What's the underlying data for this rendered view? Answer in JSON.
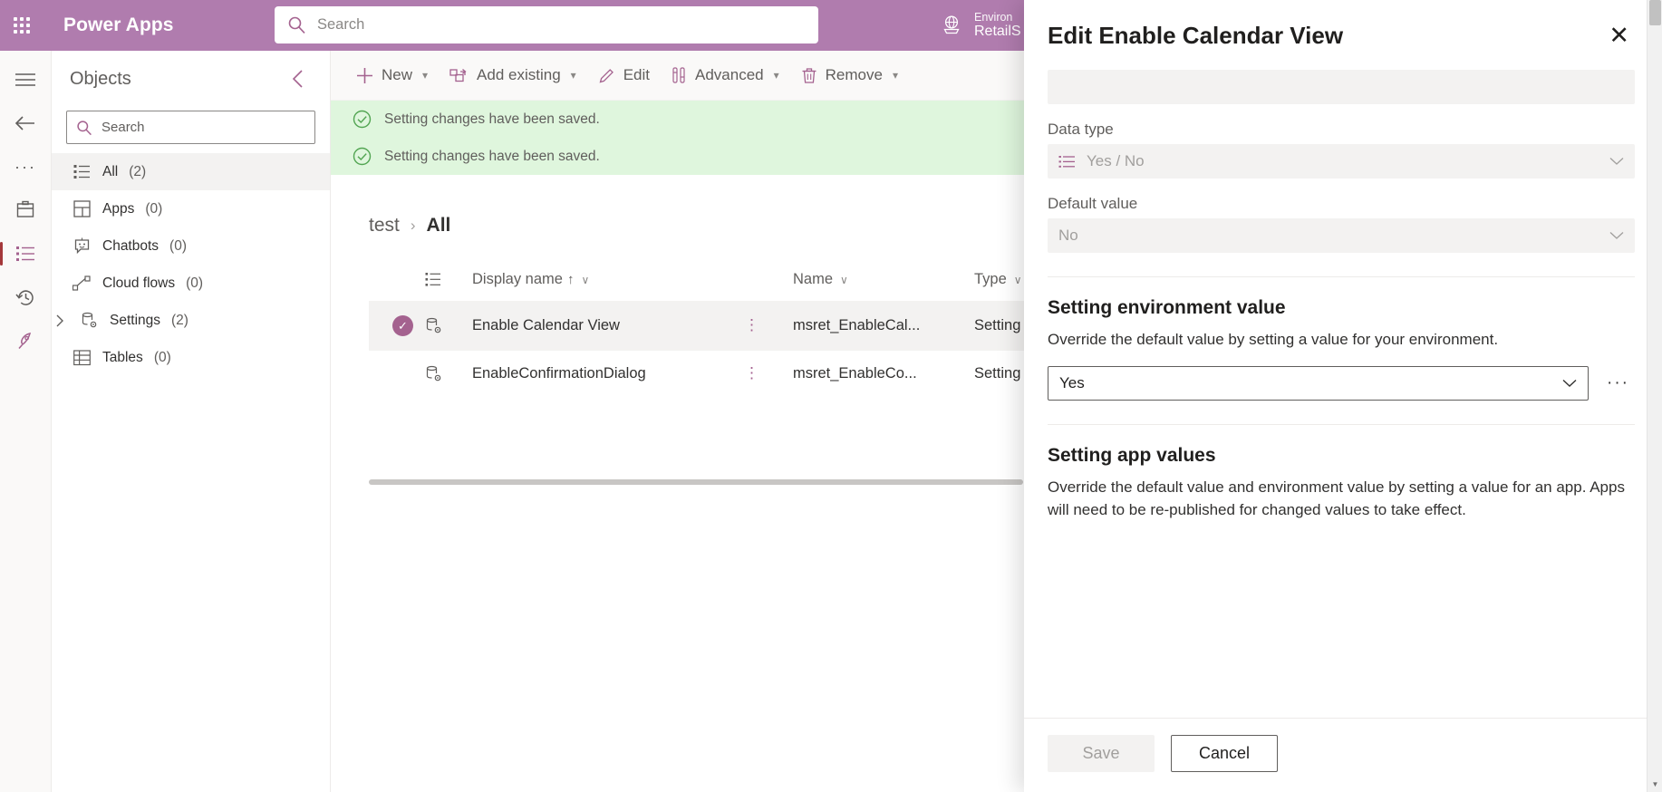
{
  "topbar": {
    "waffle_label": "app-launcher",
    "brand": "Power Apps",
    "search_placeholder": "Search",
    "search_value": "",
    "env_label": "Environ",
    "env_name": "RetailS"
  },
  "objects_panel": {
    "title": "Objects",
    "collapse_glyph": "‹",
    "search_placeholder": "Search",
    "search_value": "",
    "items": [
      {
        "label": "All",
        "count": "(2)",
        "icon": "list-icon",
        "expandable": false,
        "selected": true
      },
      {
        "label": "Apps",
        "count": "(0)",
        "icon": "apps-icon",
        "expandable": false,
        "selected": false
      },
      {
        "label": "Chatbots",
        "count": "(0)",
        "icon": "chatbot-icon",
        "expandable": false,
        "selected": false
      },
      {
        "label": "Cloud flows",
        "count": "(0)",
        "icon": "flow-icon",
        "expandable": false,
        "selected": false
      },
      {
        "label": "Settings",
        "count": "(2)",
        "icon": "settings-icon",
        "expandable": true,
        "selected": false
      },
      {
        "label": "Tables",
        "count": "(0)",
        "icon": "table-icon",
        "expandable": false,
        "selected": false
      }
    ]
  },
  "command_bar": {
    "back_glyph": "‹",
    "items": [
      {
        "label": "New",
        "icon": "plus-icon",
        "has_chevron": true
      },
      {
        "label": "Add existing",
        "icon": "add-existing-icon",
        "has_chevron": true
      },
      {
        "label": "Edit",
        "icon": "pencil-icon",
        "has_chevron": false
      },
      {
        "label": "Advanced",
        "icon": "advanced-icon",
        "has_chevron": true
      },
      {
        "label": "Remove",
        "icon": "trash-icon",
        "has_chevron": true
      }
    ]
  },
  "notifications": [
    {
      "icon": "check-circle-icon",
      "message": "Setting changes have been saved."
    },
    {
      "icon": "check-circle-icon",
      "message": "Setting changes have been saved."
    }
  ],
  "breadcrumb": {
    "parent": "test",
    "separator": "›",
    "current": "All"
  },
  "grid": {
    "columns": [
      {
        "label": "Display name",
        "sort": "↑",
        "chevron": "∨"
      },
      {
        "label": "Name",
        "sort": "",
        "chevron": "∨"
      },
      {
        "label": "Type",
        "sort": "",
        "chevron": "∨"
      }
    ],
    "rows": [
      {
        "selected": true,
        "check_glyph": "✓",
        "row_icon": "setting-record-icon",
        "display_name": "Enable Calendar View",
        "kebab": "⋮",
        "name": "msret_EnableCal...",
        "type": "Setting"
      },
      {
        "selected": false,
        "check_glyph": "",
        "row_icon": "setting-record-icon",
        "display_name": "EnableConfirmationDialog",
        "kebab": "⋮",
        "name": "msret_EnableCo...",
        "type": "Setting"
      }
    ]
  },
  "edit_panel": {
    "title": "Edit Enable Calendar View",
    "close_glyph": "✕",
    "top_readonly_value": "",
    "data_type": {
      "label": "Data type",
      "value": "Yes / No",
      "icon": "choice-list-icon",
      "chevron": "∨",
      "disabled": true
    },
    "default_value": {
      "label": "Default value",
      "value": "No",
      "chevron": "∨",
      "disabled": true
    },
    "environment_section": {
      "title": "Setting environment value",
      "description": "Override the default value by setting a value for your environment.",
      "combo_value": "Yes",
      "chevron": "∨",
      "overflow_glyph": "···"
    },
    "app_section": {
      "title": "Setting app values",
      "description": "Override the default value and environment value by setting a value for an app. Apps will need to be re-published for changed values to take effect."
    },
    "footer": {
      "save_label": "Save",
      "cancel_label": "Cancel"
    }
  },
  "colors": {
    "brand_purple": "#b07cae",
    "accent_purple": "#a4628f",
    "success_green_bg": "#dff6dd",
    "success_green": "#107c10"
  }
}
